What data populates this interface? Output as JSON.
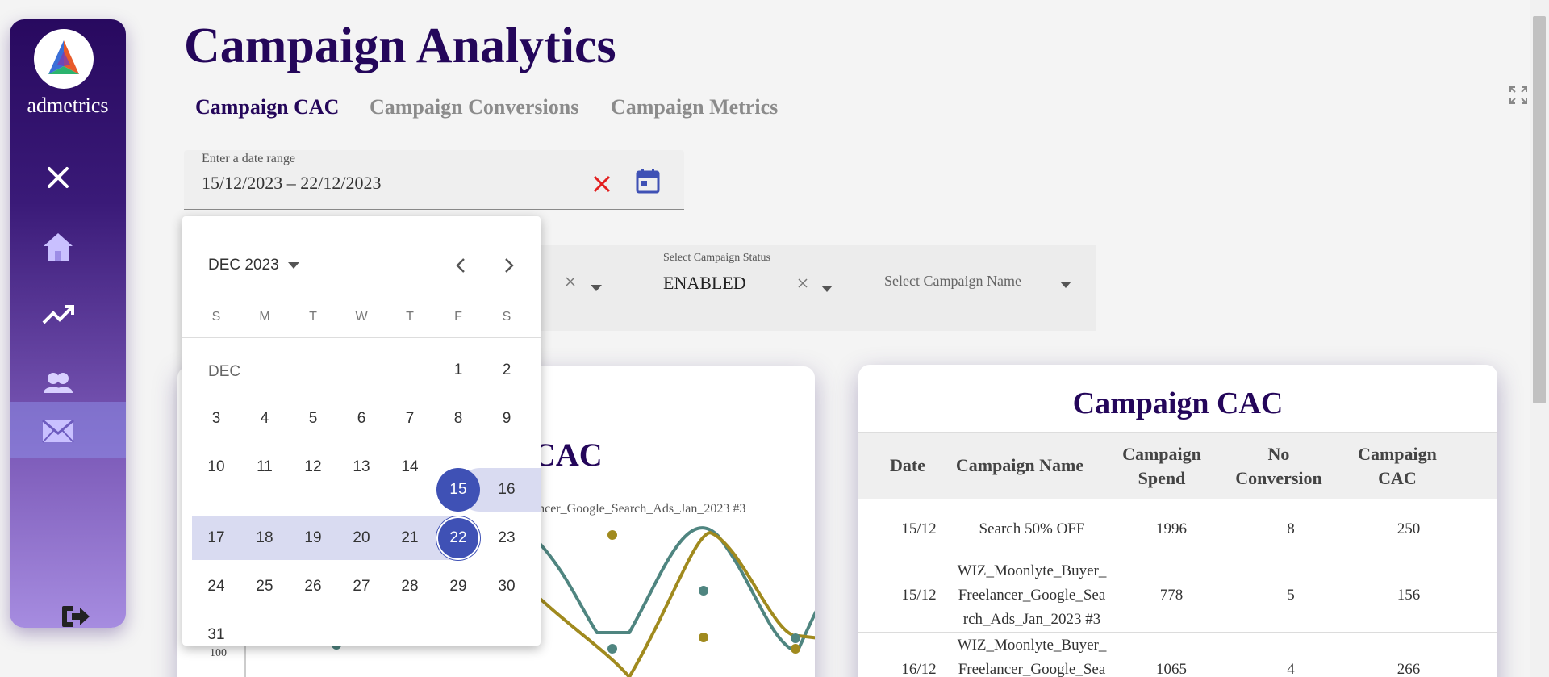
{
  "sidebar": {
    "brand": "admetrics",
    "items": [
      {
        "icon": "close-icon"
      },
      {
        "icon": "home-icon"
      },
      {
        "icon": "trending-up-icon"
      },
      {
        "icon": "users-icon"
      },
      {
        "icon": "mail-icon",
        "active": true
      },
      {
        "icon": "logout-icon"
      }
    ]
  },
  "header": {
    "title": "Campaign Analytics",
    "tabs": [
      {
        "label": "Campaign CAC",
        "active": true
      },
      {
        "label": "Campaign Conversions"
      },
      {
        "label": "Campaign Metrics"
      }
    ]
  },
  "date_range": {
    "label": "Enter a date range",
    "value": "15/12/2023 – 22/12/2023"
  },
  "filters": {
    "status_label": "Select Campaign Status",
    "status_value": "ENABLED",
    "name_placeholder": "Select Campaign Name"
  },
  "calendar": {
    "period": "DEC 2023",
    "weekdays": [
      "S",
      "M",
      "T",
      "W",
      "T",
      "F",
      "S"
    ],
    "month_label": "DEC",
    "days": [
      "1",
      "2",
      "3",
      "4",
      "5",
      "6",
      "7",
      "8",
      "9",
      "10",
      "11",
      "12",
      "13",
      "14",
      "15",
      "16",
      "17",
      "18",
      "19",
      "20",
      "21",
      "22",
      "23",
      "24",
      "25",
      "26",
      "27",
      "28",
      "29",
      "30",
      "31"
    ],
    "range_start": "15",
    "range_end": "22"
  },
  "chart_card": {
    "title_fragment": "CAC",
    "legend_fragment": "ancer_Google_Search_Ads_Jan_2023 #3",
    "y_tick": "100"
  },
  "table": {
    "title": "Campaign CAC",
    "headers": [
      "Date",
      "Campaign Name",
      "Campaign Spend",
      "No Conversion",
      "Campaign CAC"
    ],
    "rows": [
      {
        "date": "15/12",
        "name": "Search 50% OFF",
        "spend": "1996",
        "conversions": "8",
        "cac": "250"
      },
      {
        "date": "15/12",
        "name": "WIZ_Moonlyte_Buyer_ Freelancer_Google_Sea rch_Ads_Jan_2023 #3",
        "spend": "778",
        "conversions": "5",
        "cac": "156"
      },
      {
        "date": "16/12",
        "name": "WIZ_Moonlyte_Buyer_ Freelancer_Google_Sea",
        "spend": "1065",
        "conversions": "4",
        "cac": "266"
      }
    ]
  },
  "colors": {
    "brand_dark": "#24065a",
    "accent": "#3f51b5",
    "series_gold": "#a08a1e",
    "series_teal": "#4f8580",
    "clear_red": "#e32020"
  }
}
